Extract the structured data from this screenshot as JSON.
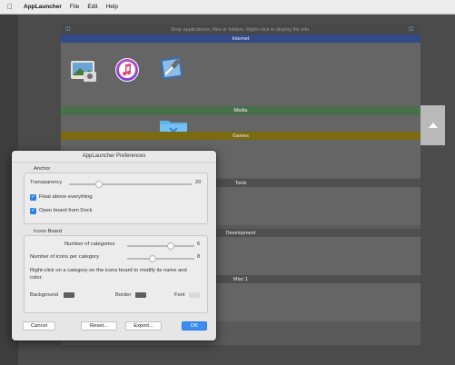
{
  "menubar": {
    "app_name": "AppLauncher",
    "items": [
      "File",
      "Edit",
      "Help"
    ]
  },
  "board": {
    "hint": "Drop applications, files or folders. Right-click to display file info.",
    "categories": [
      {
        "name": "Internet",
        "color": "#344a86"
      },
      {
        "name": "Media",
        "color": "#48704b"
      },
      {
        "name": "Games",
        "color": "#7a6a10"
      },
      {
        "name": "Tools",
        "color": "#4f4f4f"
      },
      {
        "name": "Development",
        "color": "#4f4f4f"
      },
      {
        "name": "Misc 1",
        "color": "#4f4f4f"
      }
    ]
  },
  "prefs": {
    "title": "AppLauncher Preferences",
    "anchor": {
      "label": "Anchor",
      "transparency_label": "Transparency",
      "transparency_value": "20",
      "float_label": "Float above everything",
      "open_label": "Open board from Dock"
    },
    "icons_board": {
      "label": "Icons Board",
      "categories_label": "Number of categories",
      "categories_value": "6",
      "icons_label": "Number of icons per category",
      "icons_value": "8",
      "info": "Right-click on a category on the icons board to modify its name and color.",
      "background_label": "Background",
      "border_label": "Border",
      "font_label": "Font"
    },
    "buttons": {
      "cancel": "Cancel",
      "reset": "Reset...",
      "export": "Export...",
      "ok": "OK"
    }
  }
}
